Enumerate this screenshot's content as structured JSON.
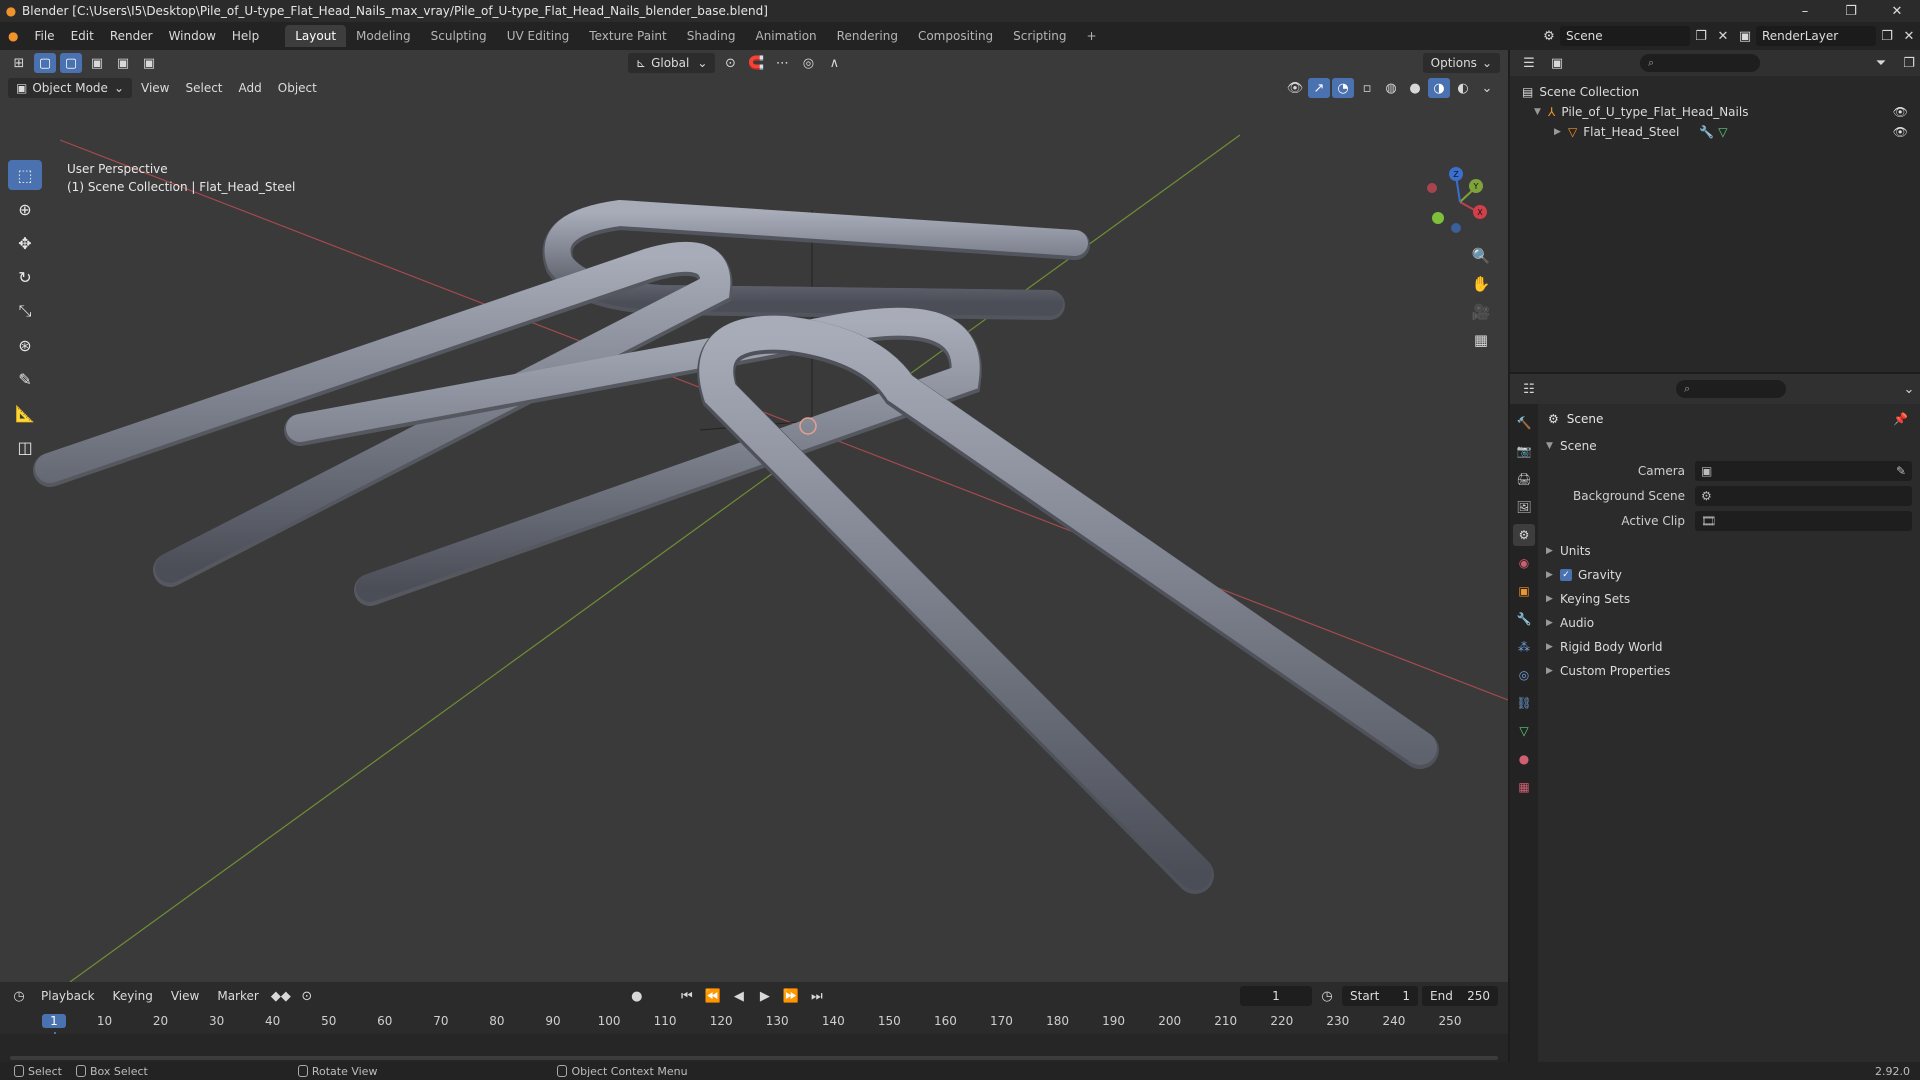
{
  "window": {
    "title": "Blender [C:\\Users\\I5\\Desktop\\Pile_of_U-type_Flat_Head_Nails_max_vray/Pile_of_U-type_Flat_Head_Nails_blender_base.blend]",
    "minimize": "–",
    "maximize": "❐",
    "close": "✕"
  },
  "menu": {
    "items": [
      "File",
      "Edit",
      "Render",
      "Window",
      "Help"
    ]
  },
  "workspaces": {
    "tabs": [
      "Layout",
      "Modeling",
      "Sculpting",
      "UV Editing",
      "Texture Paint",
      "Shading",
      "Animation",
      "Rendering",
      "Compositing",
      "Scripting"
    ],
    "add": "+"
  },
  "scene_selector": {
    "value": "Scene"
  },
  "renderlayer_selector": {
    "value": "RenderLayer"
  },
  "viewport": {
    "mode": "Object Mode",
    "menus": [
      "View",
      "Select",
      "Add",
      "Object"
    ],
    "transform_orientation": "Global",
    "options": "Options",
    "info_line1": "User Perspective",
    "info_line2": "(1) Scene Collection | Flat_Head_Steel",
    "gizmo": {
      "x": "X",
      "y": "Y",
      "z": "Z"
    }
  },
  "outliner": {
    "root": "Scene Collection",
    "collection": "Pile_of_U_type_Flat_Head_Nails",
    "object": "Flat_Head_Steel"
  },
  "properties": {
    "context_title": "Scene",
    "panel_title": "Scene",
    "fields": [
      {
        "label": "Camera",
        "value": ""
      },
      {
        "label": "Background Scene",
        "value": ""
      },
      {
        "label": "Active Clip",
        "value": ""
      }
    ],
    "subpanels": [
      "Units",
      "Gravity",
      "Keying Sets",
      "Audio",
      "Rigid Body World",
      "Custom Properties"
    ]
  },
  "timeline": {
    "menus": [
      "Playback",
      "Keying",
      "View",
      "Marker"
    ],
    "current_frame": "1",
    "start_label": "Start",
    "start_value": "1",
    "end_label": "End",
    "end_value": "250",
    "ruler": [
      "1",
      "10",
      "20",
      "30",
      "40",
      "50",
      "60",
      "70",
      "80",
      "90",
      "100",
      "110",
      "120",
      "130",
      "140",
      "150",
      "160",
      "170",
      "180",
      "190",
      "200",
      "210",
      "220",
      "230",
      "240",
      "250"
    ]
  },
  "statusbar": {
    "select": "Select",
    "box_select": "Box Select",
    "rotate_view": "Rotate View",
    "context_menu": "Object Context Menu",
    "version": "2.92.0"
  },
  "colors": {
    "accent": "#4a72b0",
    "x_axis": "#c0404a",
    "y_axis": "#7fa33a",
    "z_axis": "#3a6fd0",
    "viewport_bg": "#3a3a3a"
  }
}
